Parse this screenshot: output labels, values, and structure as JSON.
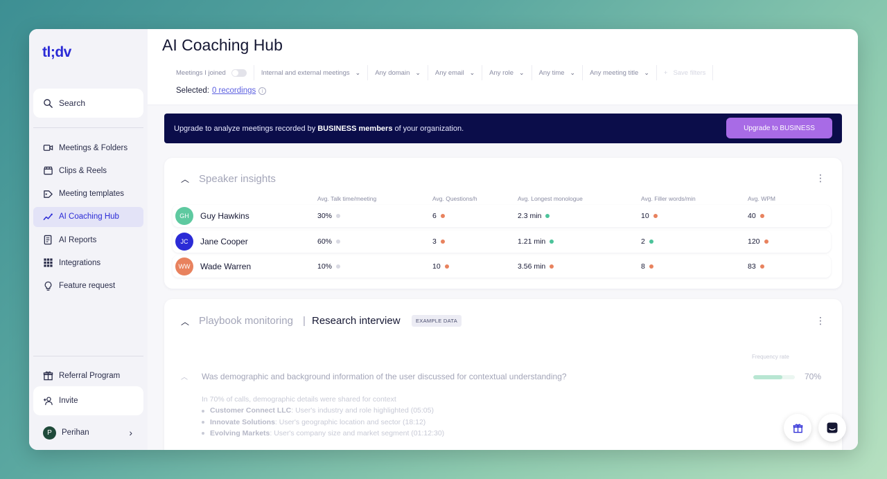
{
  "app": {
    "logo": "tl;dv"
  },
  "sidebar": {
    "search_label": "Search",
    "items": [
      {
        "label": "Meetings & Folders",
        "icon": "video-camera-icon",
        "active": false
      },
      {
        "label": "Clips & Reels",
        "icon": "clapperboard-icon",
        "active": false
      },
      {
        "label": "Meeting templates",
        "icon": "template-tag-icon",
        "active": false
      },
      {
        "label": "AI Coaching Hub",
        "icon": "trend-chart-icon",
        "active": true
      },
      {
        "label": "AI Reports",
        "icon": "report-icon",
        "active": false
      },
      {
        "label": "Integrations",
        "icon": "grid-icon",
        "active": false
      },
      {
        "label": "Feature request",
        "icon": "lightbulb-icon",
        "active": false
      }
    ],
    "referral_label": "Referral Program",
    "invite_label": "Invite",
    "user": {
      "initial": "P",
      "name": "Perihan"
    }
  },
  "header": {
    "title": "AI Coaching Hub",
    "filters": {
      "meetings_joined": "Meetings I joined",
      "meeting_scope": "Internal and external meetings",
      "domain": "Any domain",
      "email": "Any email",
      "role": "Any role",
      "time": "Any time",
      "meeting_title": "Any meeting title",
      "save_filters": "Save filters"
    },
    "selected_label": "Selected:",
    "selected_link": "0 recordings"
  },
  "banner": {
    "text_before": "Upgrade to analyze meetings recorded by",
    "text_bold": "BUSINESS members",
    "text_after": "of your organization.",
    "button_label": "Upgrade to BUSINESS"
  },
  "speaker_insights": {
    "title": "Speaker insights",
    "columns": [
      "Avg. Talk time/meeting",
      "Avg. Questions/h",
      "Avg. Longest monologue",
      "Avg. Filler words/min",
      "Avg. WPM"
    ],
    "rows": [
      {
        "initials": "GH",
        "name": "Guy Hawkins",
        "avatar_color": "#5ec9a0",
        "talk_time": "30%",
        "talk_dot": "#d8d9e2",
        "questions": "6",
        "questions_dot": "#e8825e",
        "monologue": "2.3 min",
        "monologue_dot": "#4cc39a",
        "filler": "10",
        "filler_dot": "#e8825e",
        "wpm": "40",
        "wpm_dot": "#e8825e"
      },
      {
        "initials": "JC",
        "name": "Jane Cooper",
        "avatar_color": "#2b2bd6",
        "talk_time": "60%",
        "talk_dot": "#d8d9e2",
        "questions": "3",
        "questions_dot": "#e8825e",
        "monologue": "1.21 min",
        "monologue_dot": "#4cc39a",
        "filler": "2",
        "filler_dot": "#4cc39a",
        "wpm": "120",
        "wpm_dot": "#e8825e"
      },
      {
        "initials": "WW",
        "name": "Wade Warren",
        "avatar_color": "#e8825e",
        "talk_time": "10%",
        "talk_dot": "#d8d9e2",
        "questions": "10",
        "questions_dot": "#e8825e",
        "monologue": "3.56 min",
        "monologue_dot": "#e8825e",
        "filler": "8",
        "filler_dot": "#e8825e",
        "wpm": "83",
        "wpm_dot": "#e8825e"
      }
    ]
  },
  "playbook": {
    "title": "Playbook monitoring",
    "separator": "|",
    "name": "Research interview",
    "badge": "EXAMPLE DATA",
    "frequency_label": "Frequency rate",
    "question": "Was demographic and background information of the user discussed for contextual understanding?",
    "frequency_value": 0.7,
    "frequency_pct": "70%",
    "summary": "In 70% of calls, demographic details were shared for context",
    "details": [
      {
        "company": "Customer Connect LLC",
        "text": ": User's industry and role highlighted (05:05)"
      },
      {
        "company": "Innovate Solutions",
        "text": ": User's geographic location and sector (18:12)"
      },
      {
        "company": "Evolving Markets",
        "text": ": User's company size and market segment (01:12:30)"
      }
    ]
  },
  "colors": {
    "accent": "#2b2bd6",
    "banner_bg": "#0b0d4a",
    "upgrade_button": "#a86be6"
  }
}
